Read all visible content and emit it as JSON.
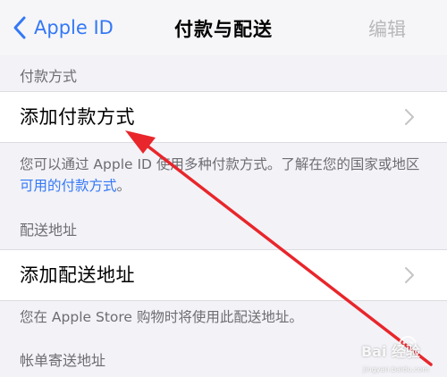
{
  "nav": {
    "back_label": "Apple ID",
    "title": "付款与配送",
    "edit_label": "编辑"
  },
  "payment": {
    "header": "付款方式",
    "add_label": "添加付款方式",
    "note_prefix": "您可以通过 Apple ID 使用多种付款方式。了解在您的国家或地区",
    "note_link": "可用的付款方式",
    "note_suffix": "。"
  },
  "shipping": {
    "header": "配送地址",
    "add_label": "添加配送地址",
    "note": "您在 Apple Store 购物时将使用此配送地址。"
  },
  "billing": {
    "header": "帐单寄送地址"
  },
  "colors": {
    "accent": "#3478f6",
    "annotation_arrow": "#e8262b",
    "background": "#f2f2f7"
  },
  "watermark": {
    "brand": "Bai 经验",
    "domain": "jingyan.baidu.com"
  }
}
